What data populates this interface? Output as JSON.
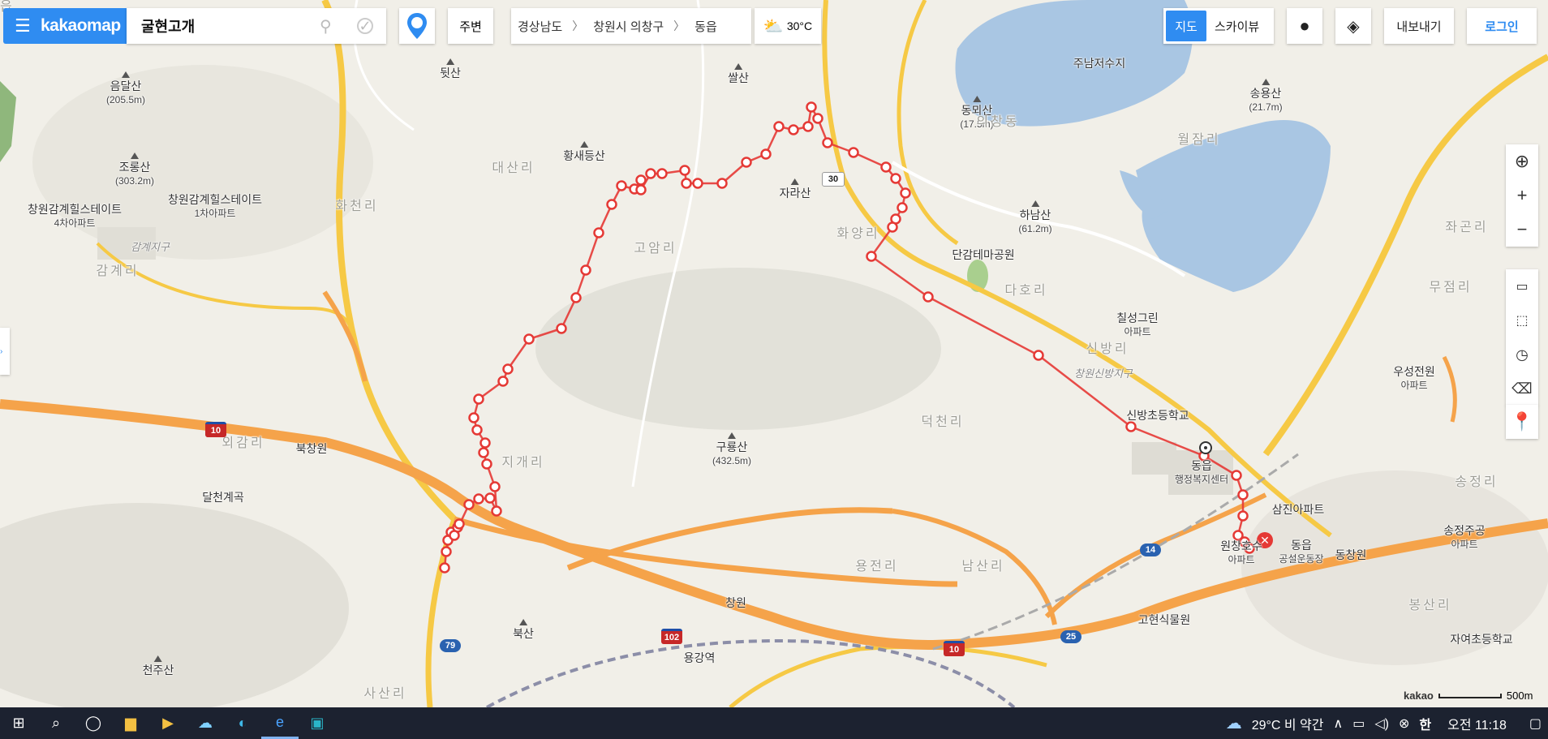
{
  "app": {
    "logo": "kakaomap"
  },
  "search": {
    "value": "굴현고개"
  },
  "toolbar": {
    "nearby_label": "주변"
  },
  "breadcrumb": [
    "경상남도",
    "창원시 의창구",
    "동읍"
  ],
  "weather": {
    "temp": "30°C"
  },
  "right_controls": {
    "map_label": "지도",
    "skyview_label": "스카이뷰",
    "export_label": "내보내기",
    "login_label": "로그인"
  },
  "colors": {
    "accent": "#2f8cf1",
    "route": "#e53935",
    "highway": "#f5a34a",
    "road_yellow": "#f6c945",
    "water": "#a9c6e3"
  },
  "map": {
    "labels": [
      {
        "text": "음달산",
        "sub": "(205.5m)",
        "type": "peak"
      },
      {
        "text": "조롱산",
        "sub": "(303.2m)",
        "type": "peak"
      },
      {
        "text": "뒷산",
        "sub": "",
        "type": "peak"
      },
      {
        "text": "황새등산",
        "sub": "",
        "type": "peak"
      },
      {
        "text": "쌀산",
        "sub": "",
        "type": "peak"
      },
      {
        "text": "자라산",
        "sub": "",
        "type": "peak"
      },
      {
        "text": "하남산",
        "sub": "(61.2m)",
        "type": "peak"
      },
      {
        "text": "동뫼산",
        "sub": "(17.5m)",
        "type": "peak"
      },
      {
        "text": "송용산",
        "sub": "(21.7m)",
        "type": "peak"
      },
      {
        "text": "구룡산",
        "sub": "(432.5m)",
        "type": "peak"
      },
      {
        "text": "북산",
        "sub": "",
        "type": "peak"
      },
      {
        "text": "천주산",
        "sub": "",
        "type": "peak"
      },
      {
        "text": "창원감계힐스테이트",
        "sub": "4차아파트",
        "type": "poi"
      },
      {
        "text": "창원감계힐스테이트",
        "sub": "1차아파트",
        "type": "poi"
      },
      {
        "text": "감계지구",
        "sub": "",
        "type": "area"
      },
      {
        "text": "주남저수지",
        "sub": "",
        "type": "poi"
      },
      {
        "text": "단감테마공원",
        "sub": "",
        "type": "poi"
      },
      {
        "text": "칠성그린",
        "sub": "아파트",
        "type": "poi"
      },
      {
        "text": "창원신방지구",
        "sub": "",
        "type": "area"
      },
      {
        "text": "신방초등학교",
        "sub": "",
        "type": "poi"
      },
      {
        "text": "동읍",
        "sub": "행정복지센터",
        "type": "poi"
      },
      {
        "text": "삼진아파트",
        "sub": "",
        "type": "poi"
      },
      {
        "text": "원창호수",
        "sub": "아파트",
        "type": "poi"
      },
      {
        "text": "동읍",
        "sub": "공설운동장",
        "type": "poi"
      },
      {
        "text": "송정주공",
        "sub": "아파트",
        "type": "poi"
      },
      {
        "text": "우성전원",
        "sub": "아파트",
        "type": "poi"
      },
      {
        "text": "고현식물원",
        "sub": "",
        "type": "poi"
      },
      {
        "text": "자여초등학교",
        "sub": "",
        "type": "poi"
      },
      {
        "text": "북창원",
        "sub": "",
        "type": "poi"
      },
      {
        "text": "달천계곡",
        "sub": "",
        "type": "poi"
      },
      {
        "text": "창원",
        "sub": "",
        "type": "poi"
      },
      {
        "text": "용강역",
        "sub": "",
        "type": "poi"
      },
      {
        "text": "동창원",
        "sub": "",
        "type": "poi"
      },
      {
        "text": "대산리",
        "sub": "",
        "type": "dist"
      },
      {
        "text": "화천리",
        "sub": "",
        "type": "dist"
      },
      {
        "text": "고암리",
        "sub": "",
        "type": "dist"
      },
      {
        "text": "화양리",
        "sub": "",
        "type": "dist"
      },
      {
        "text": "다호리",
        "sub": "",
        "type": "dist"
      },
      {
        "text": "신방리",
        "sub": "",
        "type": "dist"
      },
      {
        "text": "월잠리",
        "sub": "",
        "type": "dist"
      },
      {
        "text": "무점리",
        "sub": "",
        "type": "dist"
      },
      {
        "text": "좌곤리",
        "sub": "",
        "type": "dist"
      },
      {
        "text": "감계리",
        "sub": "",
        "type": "dist"
      },
      {
        "text": "외감리",
        "sub": "",
        "type": "dist"
      },
      {
        "text": "지개리",
        "sub": "",
        "type": "dist"
      },
      {
        "text": "덕천리",
        "sub": "",
        "type": "dist"
      },
      {
        "text": "용전리",
        "sub": "",
        "type": "dist"
      },
      {
        "text": "남산리",
        "sub": "",
        "type": "dist"
      },
      {
        "text": "송정리",
        "sub": "",
        "type": "dist"
      },
      {
        "text": "봉산리",
        "sub": "",
        "type": "dist"
      },
      {
        "text": "사산리",
        "sub": "",
        "type": "dist"
      },
      {
        "text": "의창동",
        "sub": "",
        "type": "dist"
      },
      {
        "text": "동읍",
        "sub": "",
        "type": "dist"
      }
    ],
    "road_shields": [
      "10",
      "10",
      "102",
      "79",
      "14",
      "25",
      "30"
    ]
  },
  "scale": {
    "brand": "kakao",
    "distance": "500m"
  },
  "taskbar": {
    "weather": "29°C 비 약간",
    "ime": "한",
    "clock": "오전 11:18"
  }
}
